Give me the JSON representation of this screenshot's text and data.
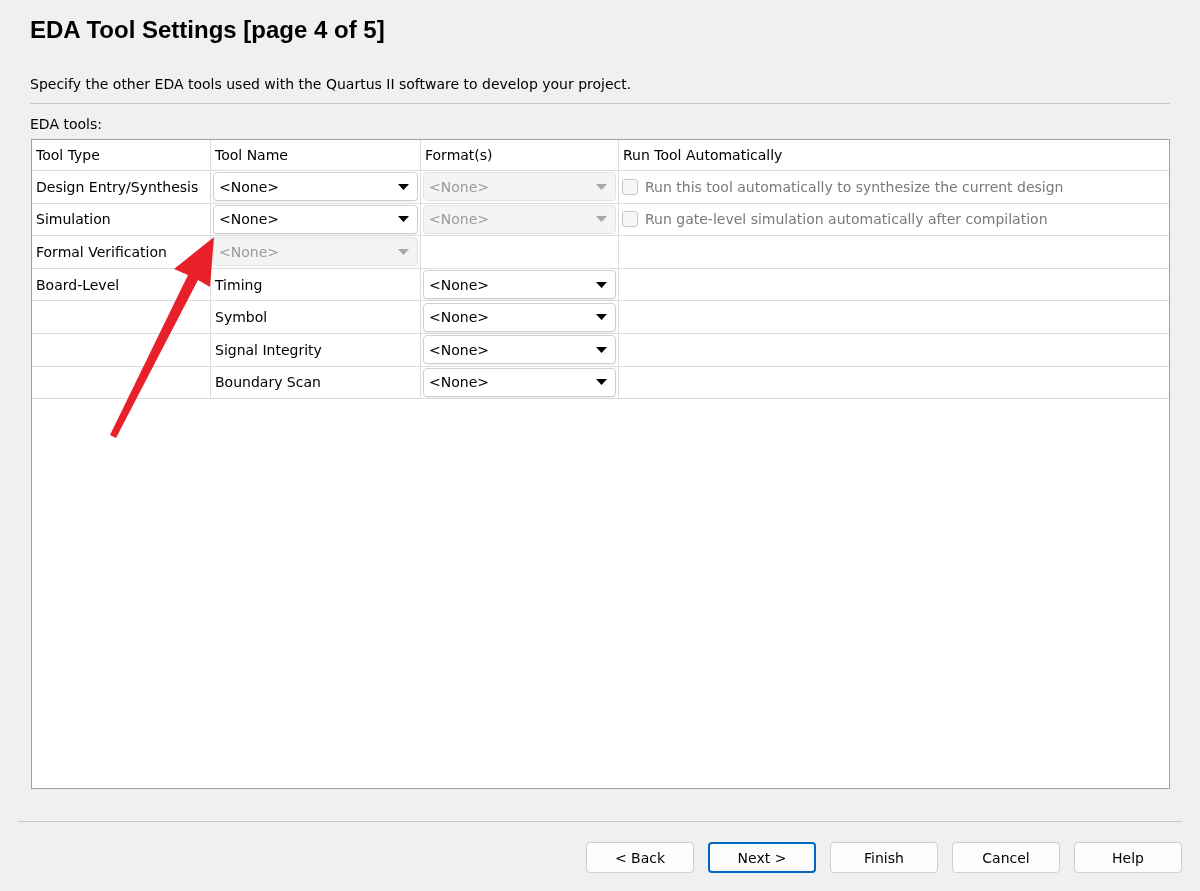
{
  "title": "EDA Tool Settings [page 4 of 5]",
  "description": "Specify the other EDA tools used with the Quartus II software to develop your project.",
  "table_label": "EDA tools:",
  "columns": [
    "Tool Type",
    "Tool Name",
    "Format(s)",
    "Run Tool Automatically"
  ],
  "rows": [
    {
      "kind": "tool",
      "tool_type": "Design Entry/Synthesis",
      "tool_name": {
        "value": "<None>",
        "disabled": false
      },
      "format": {
        "value": "<None>",
        "disabled": true
      },
      "run_auto": {
        "label": "Run this tool automatically to synthesize the current design",
        "checked": false,
        "disabled": true
      }
    },
    {
      "kind": "tool",
      "tool_type": "Simulation",
      "tool_name": {
        "value": "<None>",
        "disabled": false
      },
      "format": {
        "value": "<None>",
        "disabled": true
      },
      "run_auto": {
        "label": "Run gate-level simulation automatically after compilation",
        "checked": false,
        "disabled": true
      }
    },
    {
      "kind": "tool",
      "tool_type": "Formal Verification",
      "tool_name": {
        "value": "<None>",
        "disabled": true
      }
    },
    {
      "kind": "board",
      "tool_type": "Board-Level",
      "sub_type": "Timing",
      "format": {
        "value": "<None>",
        "disabled": false
      }
    },
    {
      "kind": "board",
      "sub_type": "Symbol",
      "format": {
        "value": "<None>",
        "disabled": false
      }
    },
    {
      "kind": "board",
      "sub_type": "Signal Integrity",
      "format": {
        "value": "<None>",
        "disabled": false
      }
    },
    {
      "kind": "board",
      "sub_type": "Boundary Scan",
      "format": {
        "value": "<None>",
        "disabled": false
      }
    }
  ],
  "buttons": [
    {
      "label": "< Back",
      "selected": false
    },
    {
      "label": "Next >",
      "selected": true
    },
    {
      "label": "Finish",
      "selected": false
    },
    {
      "label": "Cancel",
      "selected": false
    },
    {
      "label": "Help",
      "selected": false
    }
  ]
}
